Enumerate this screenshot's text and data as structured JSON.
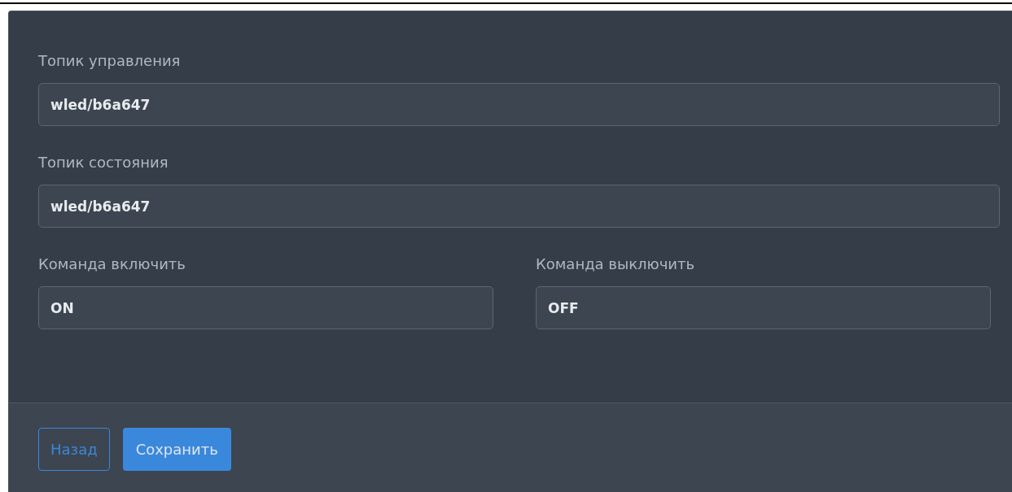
{
  "fields": [
    {
      "label": "Топик управления",
      "value": "wled/b6a647",
      "kind": "full"
    },
    {
      "label": "Топик состояния",
      "value": "wled/b6a647",
      "kind": "full"
    },
    {
      "label": "Команда включить",
      "value": "ON",
      "kind": "half"
    },
    {
      "label": "Команда выключить",
      "value": "OFF",
      "kind": "half"
    }
  ],
  "buttons": [
    {
      "label": "Назад",
      "kind": "outline"
    },
    {
      "label": "Сохранить",
      "kind": "primary"
    }
  ]
}
